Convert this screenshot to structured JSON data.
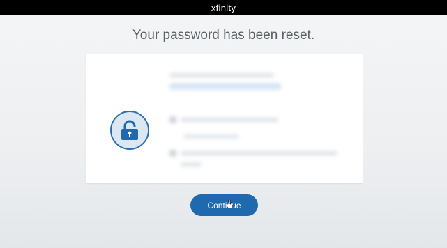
{
  "header": {
    "brand_logo_text": "xfinity"
  },
  "main": {
    "headline": "Your password has been reset.",
    "lock_icon": "unlocked-padlock-icon",
    "continue_label": "Continue"
  },
  "colors": {
    "header_bg": "#000000",
    "accent": "#1f69ae",
    "badge_bg": "#dbe8f3"
  }
}
